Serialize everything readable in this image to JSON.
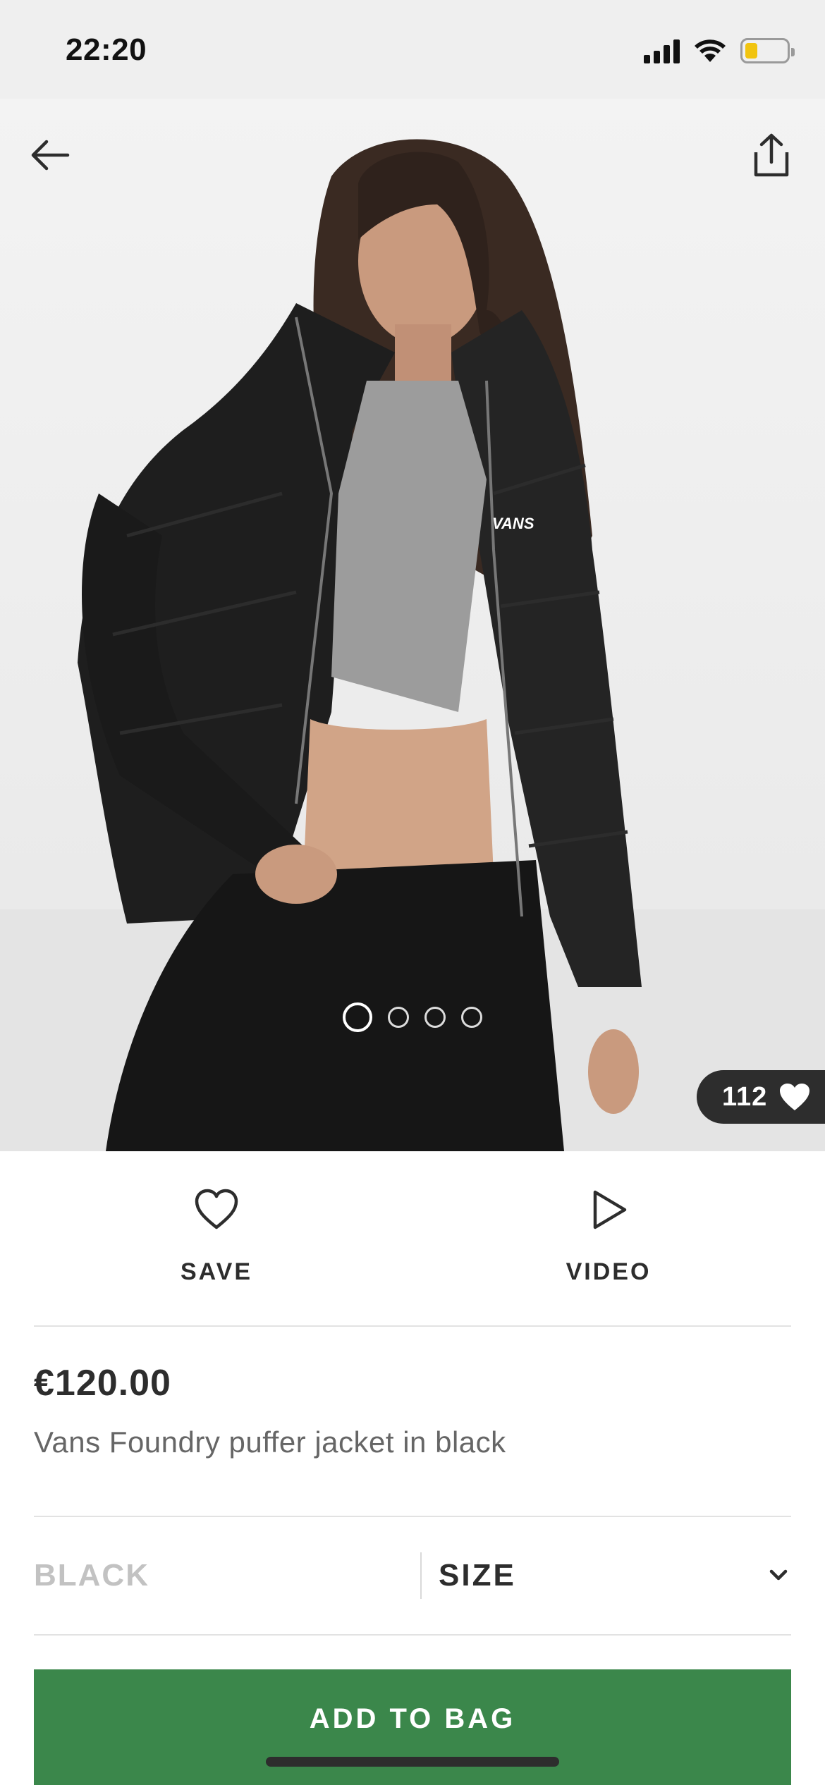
{
  "status_bar": {
    "time": "22:20",
    "icons": [
      "signal-icon",
      "wifi-icon",
      "battery-icon"
    ],
    "battery_color": "#f1c40f"
  },
  "hero": {
    "icons": {
      "back": "arrow-left-icon",
      "share": "share-icon",
      "likes": "heart-filled-icon"
    },
    "carousel": {
      "count": 4,
      "active_index": 0
    },
    "likes_count": "112"
  },
  "actions": {
    "save_label": "SAVE",
    "save_icon": "heart-outline-icon",
    "video_label": "VIDEO",
    "video_icon": "play-outline-icon"
  },
  "product": {
    "price": "€120.00",
    "title": "Vans Foundry puffer jacket in black"
  },
  "variant": {
    "colour": "BLACK",
    "size_label": "SIZE",
    "size_icon": "chevron-down-icon"
  },
  "cta": {
    "label": "ADD TO BAG",
    "color": "#3b874b"
  }
}
